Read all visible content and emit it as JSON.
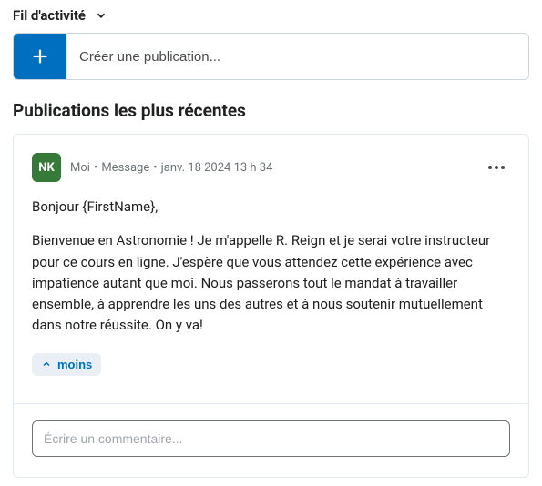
{
  "header": {
    "feed_label": "Fil d'activité"
  },
  "compose": {
    "placeholder": "Créer une publication..."
  },
  "section": {
    "title": "Publications les plus récentes"
  },
  "post": {
    "avatar_initials": "NK",
    "author": "Moi",
    "type": "Message",
    "timestamp": "janv. 18 2024 13 h 34",
    "greeting": "Bonjour {FirstName},",
    "body": "Bienvenue en Astronomie ! Je m'appelle R. Reign et je serai votre instructeur pour ce cours en ligne. J'espère que vous attendez cette expérience avec impatience autant que moi. Nous passerons tout le mandat à travailler ensemble, à apprendre les uns des autres et à nous soutenir mutuellement dans notre réussite. On y va!",
    "collapse_label": "moins"
  },
  "comment": {
    "placeholder": "Écrire un commentaire..."
  }
}
